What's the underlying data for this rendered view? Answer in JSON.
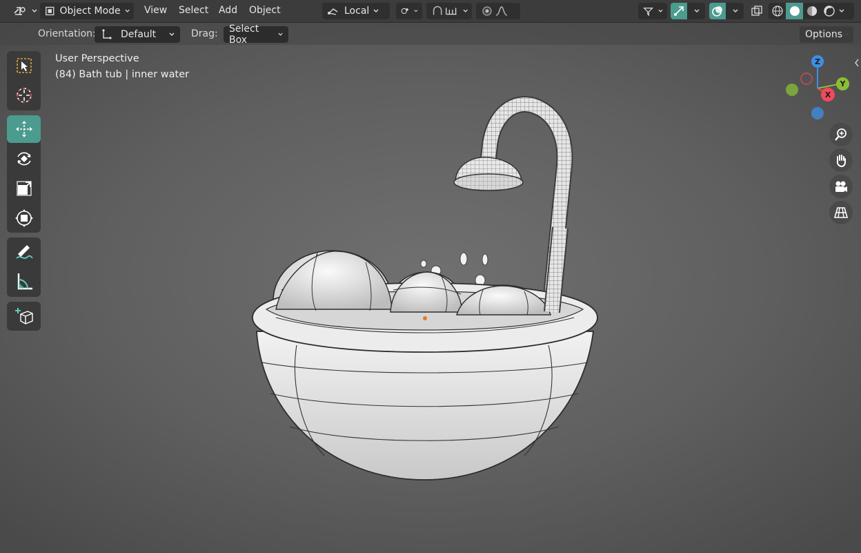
{
  "header": {
    "mode_label": "Object Mode",
    "menus": [
      "View",
      "Select",
      "Add",
      "Object"
    ],
    "transform_pivot": "Local"
  },
  "tool_settings": {
    "orientation_label": "Orientation:",
    "orientation_value": "Default",
    "drag_label": "Drag:",
    "drag_value": "Select Box",
    "options_label": "Options"
  },
  "viewport": {
    "view_name": "User Perspective",
    "object_info": "(84) Bath tub | inner water"
  },
  "gizmo": {
    "axes": [
      "Z",
      "Y",
      "X"
    ],
    "colors": {
      "x": "#f04a5c",
      "y": "#8bbe34",
      "z": "#3d8fe6",
      "active": "#4c9b8f"
    }
  },
  "left_toolbar": {
    "tools": [
      "select-box",
      "cursor",
      "move",
      "rotate",
      "scale",
      "transform",
      "annotate",
      "measure",
      "add-cube"
    ],
    "active_tool": "move"
  },
  "nav_buttons": [
    "zoom-icon",
    "hand-icon",
    "camera-icon",
    "grid-icon"
  ]
}
